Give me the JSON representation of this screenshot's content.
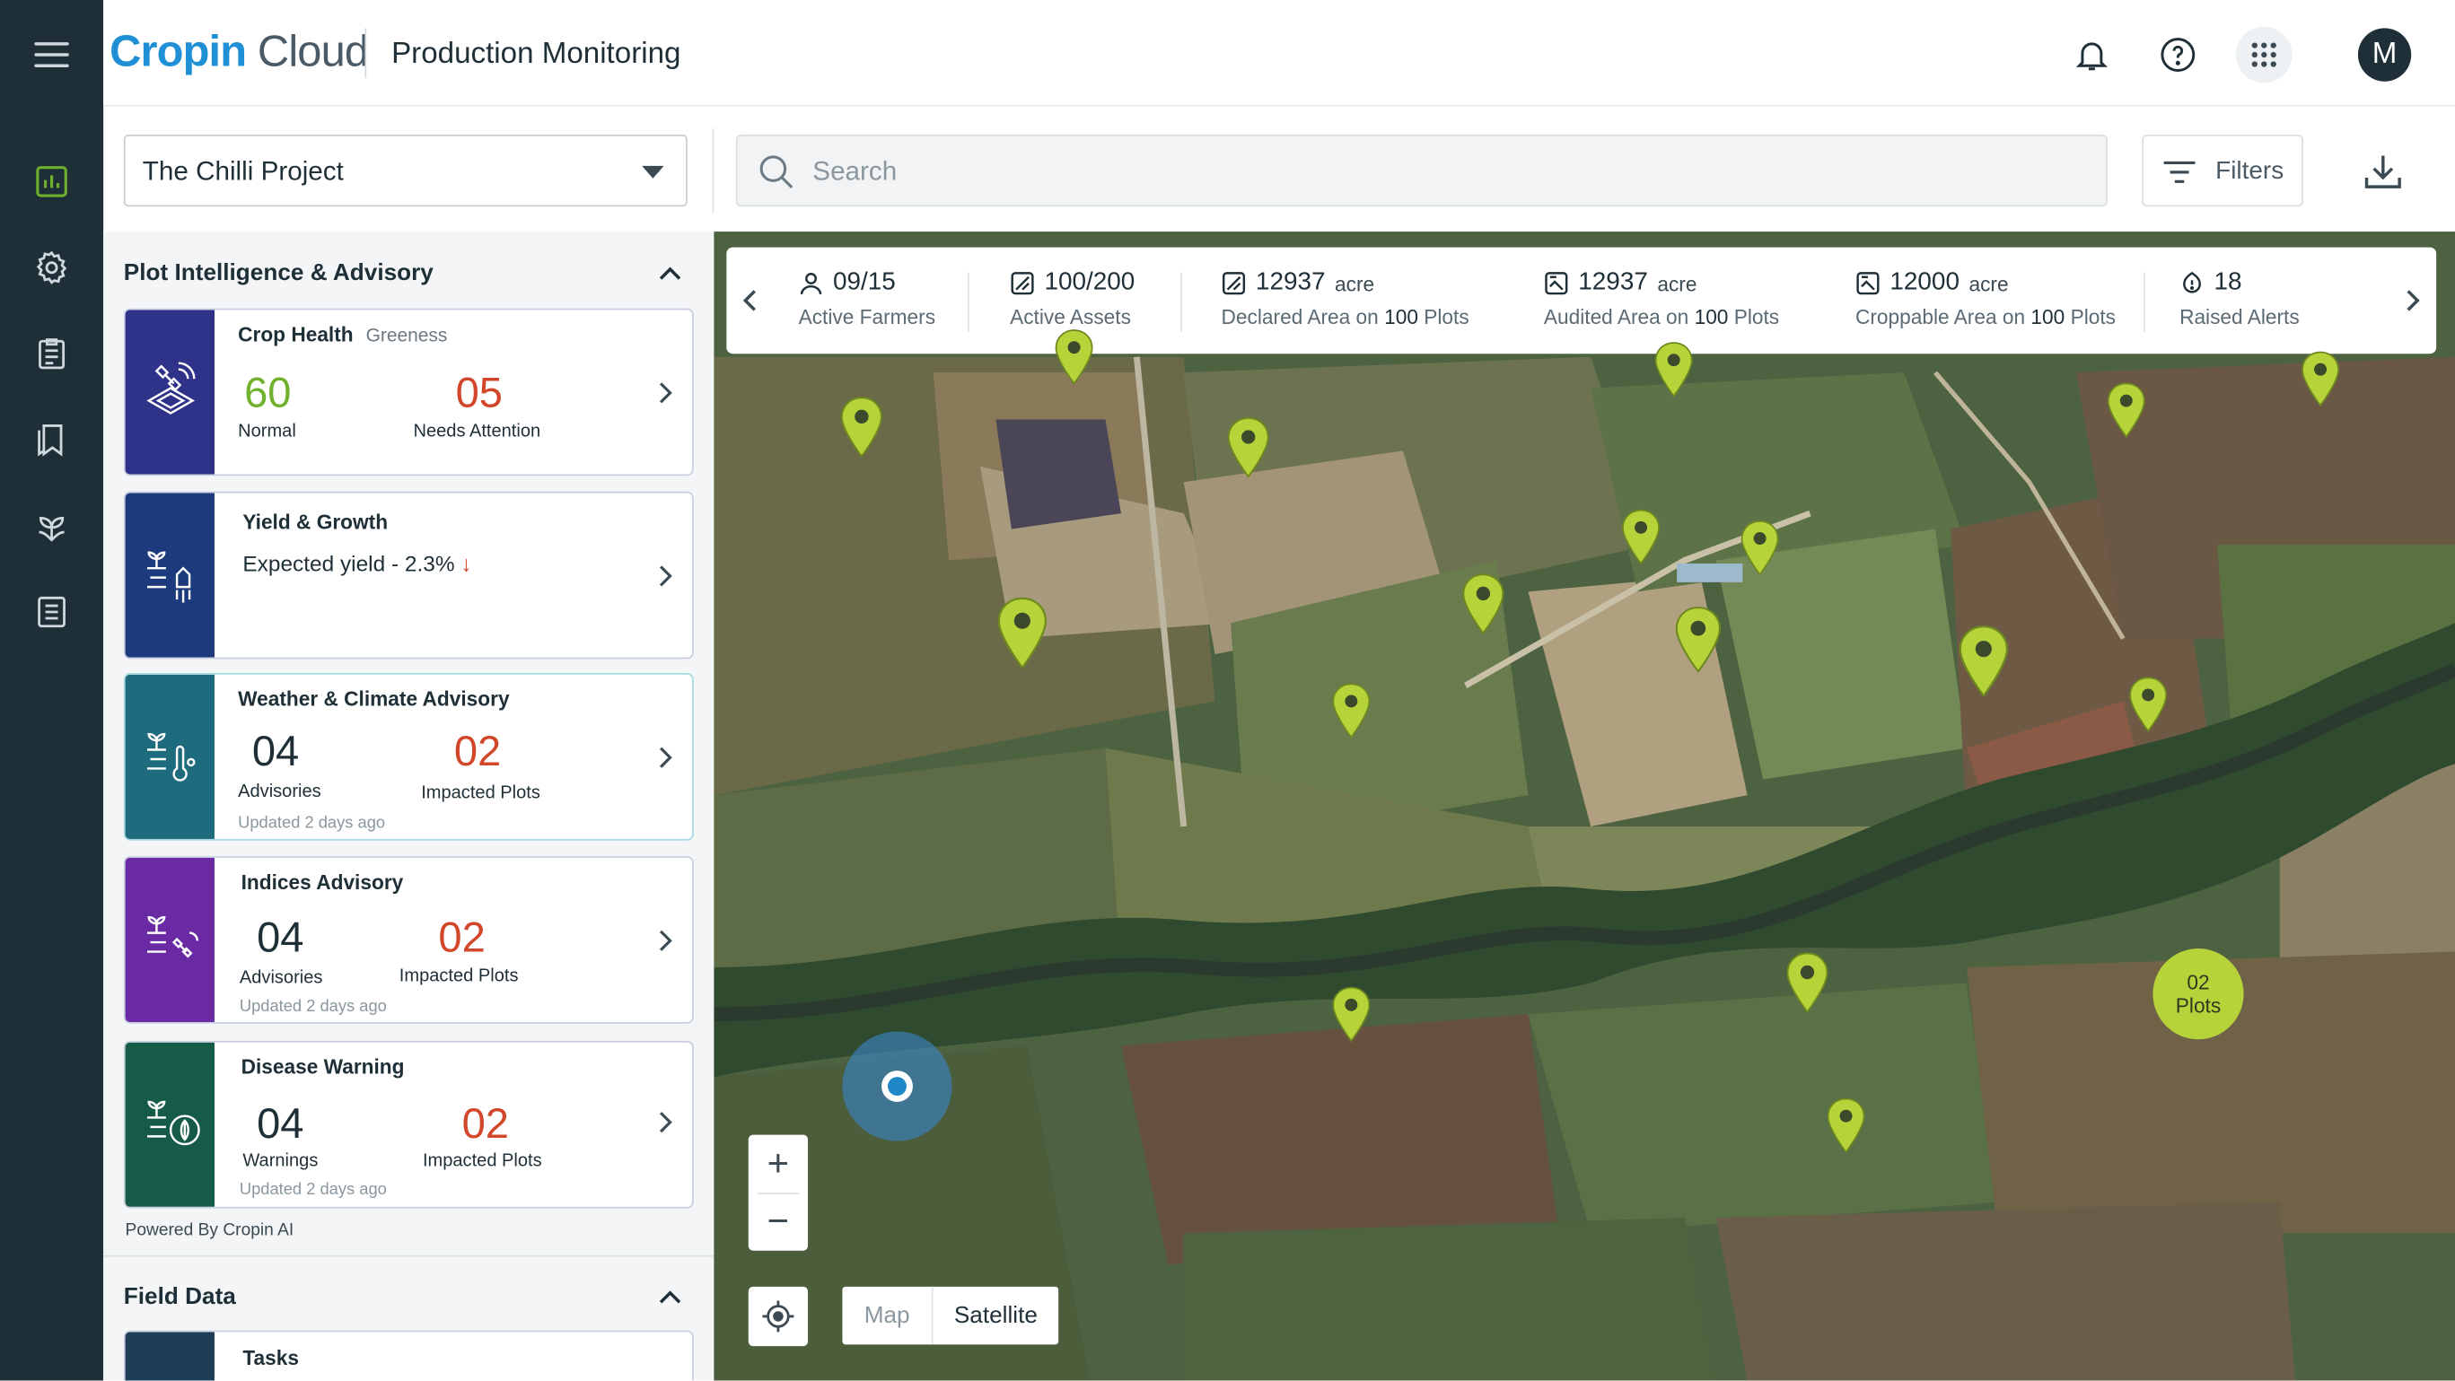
{
  "app": {
    "logo_primary": "Cropin",
    "logo_secondary": " Cloud",
    "title": "Production Monitoring",
    "avatar_initial": "M"
  },
  "nav_rail": {
    "icons": [
      "menu-icon",
      "dashboard-icon",
      "settings-icon",
      "clipboard-icon",
      "bookmarks-icon",
      "plant-icon",
      "list-icon"
    ]
  },
  "toolbar": {
    "project": "The Chilli Project",
    "search_placeholder": "Search",
    "filters_label": "Filters"
  },
  "panel": {
    "section1_title": "Plot Intelligence & Advisory",
    "cards": {
      "crop_health": {
        "title": "Crop Health",
        "subtitle": "Greeness",
        "v1": "60",
        "l1": "Normal",
        "v2": "05",
        "l2": "Needs Attention",
        "color": "#2e3288"
      },
      "yield": {
        "title": "Yield & Growth",
        "text": "Expected yield -",
        "pct": "2.3%",
        "color": "#1d3a7c"
      },
      "weather": {
        "title": "Weather & Climate Advisory",
        "v1": "04",
        "l1": "Advisories",
        "v2": "02",
        "l2": "Impacted Plots",
        "updated": "Updated 2 days ago",
        "color": "#1d6b7c"
      },
      "indices": {
        "title": "Indices Advisory",
        "v1": "04",
        "l1": "Advisories",
        "v2": "02",
        "l2": "Impacted Plots",
        "updated": "Updated 2 days ago",
        "color": "#6a2aa3"
      },
      "disease": {
        "title": "Disease Warning",
        "v1": "04",
        "l1": "Warnings",
        "v2": "02",
        "l2": "Impacted Plots",
        "updated": "Updated 2 days ago",
        "color": "#165a48"
      }
    },
    "powered_by": "Powered By Cropin AI",
    "section2_title": "Field Data",
    "tasks_title": "Tasks"
  },
  "stats": [
    {
      "value": "09/15",
      "unit": "",
      "label": "Active Farmers",
      "label_bold": "",
      "label_tail": "",
      "icon": "user-icon"
    },
    {
      "value": "100/200",
      "unit": "",
      "label": "Active Assets",
      "label_bold": "",
      "label_tail": "",
      "icon": "asset-icon"
    },
    {
      "value": "12937",
      "unit": "acre",
      "label": "Declared Area on ",
      "label_bold": "100",
      "label_tail": " Plots",
      "icon": "area-icon"
    },
    {
      "value": "12937",
      "unit": "acre",
      "label": "Audited Area on ",
      "label_bold": "100",
      "label_tail": " Plots",
      "icon": "audited-area-icon"
    },
    {
      "value": "12000",
      "unit": "acre",
      "label": "Croppable Area on ",
      "label_bold": "100",
      "label_tail": " Plots",
      "icon": "croppable-area-icon"
    },
    {
      "value": "18",
      "unit": "",
      "label": "Raised Alerts",
      "label_bold": "",
      "label_tail": "",
      "icon": "alert-icon"
    }
  ],
  "map": {
    "cluster_count": "02",
    "cluster_label": "Plots",
    "map_type_map": "Map",
    "map_type_satellite": "Satellite",
    "zoom_in": "+",
    "zoom_out": "−",
    "pin_color": "#b7d33a"
  }
}
